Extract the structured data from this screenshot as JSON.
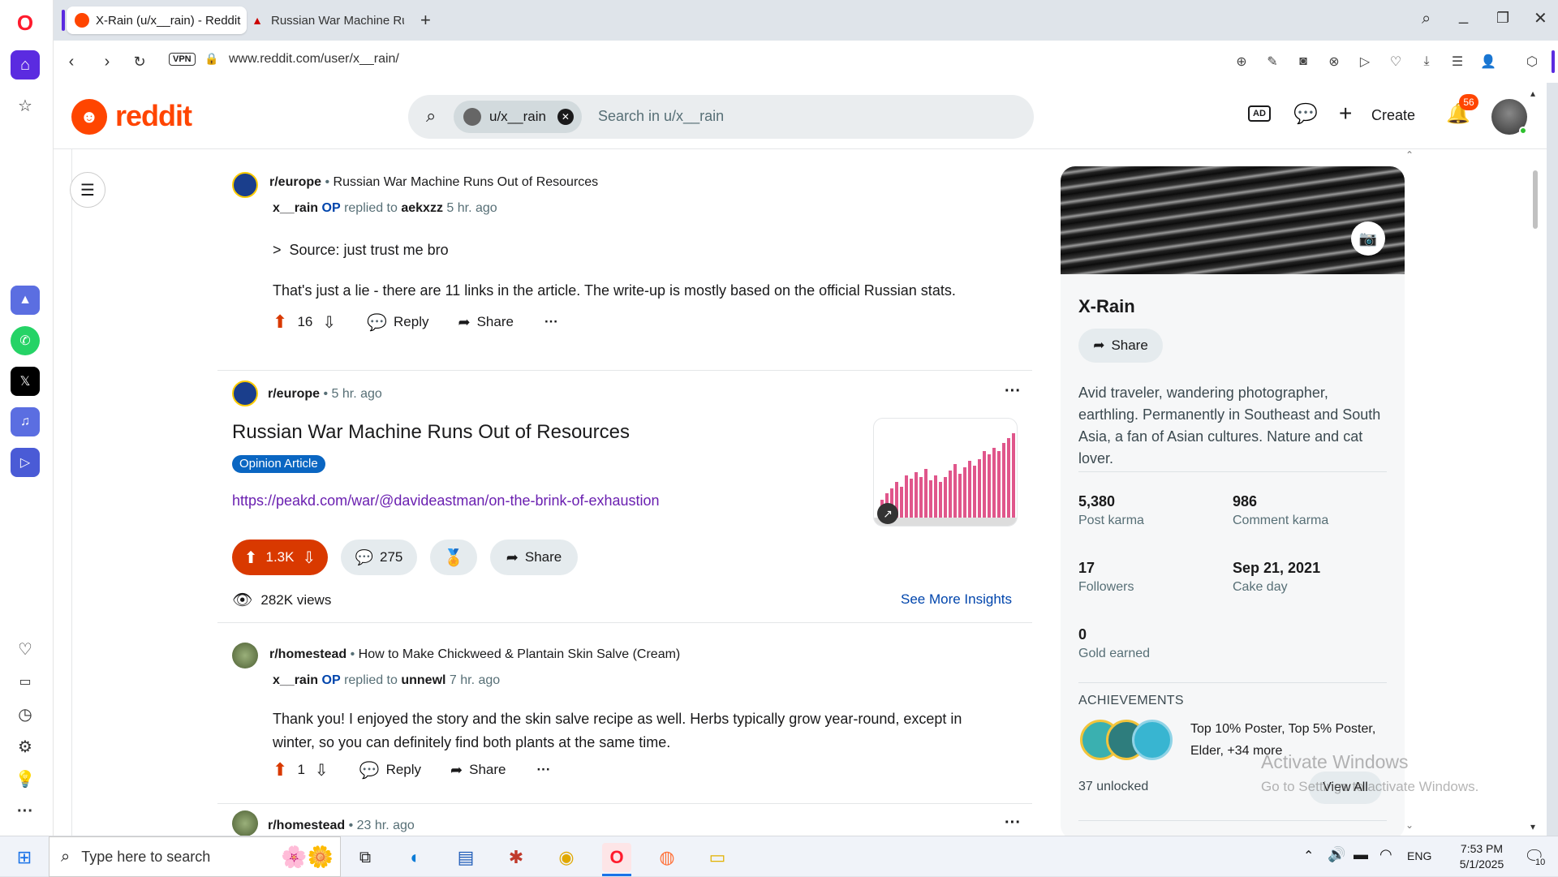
{
  "browser": {
    "tabs": [
      {
        "title": "X-Rain (u/x__rain) - Reddit",
        "active": true
      },
      {
        "title": "Russian War Machine Runs",
        "active": false
      }
    ],
    "url": "www.reddit.com/user/x__rain/",
    "vpn_label": "VPN",
    "notification_badge": ""
  },
  "header": {
    "logo_text": "reddit",
    "search_chip": "u/x__rain",
    "search_placeholder": "Search in u/x__rain",
    "create_label": "Create",
    "notif_count": "56"
  },
  "feed": [
    {
      "type": "comment",
      "subreddit": "r/europe",
      "post_title": "Russian War Machine Runs Out of Resources",
      "author": "x__rain",
      "op": "OP",
      "replied_to_label": "replied to",
      "replied_to": "aekxzz",
      "time": "5 hr. ago",
      "quote": "Source: just trust me bro",
      "body": "That's just a lie - there are 11 links in the article. The write-up is mostly based on the official Russian stats.",
      "score": "16",
      "reply": "Reply",
      "share": "Share"
    },
    {
      "type": "post",
      "subreddit": "r/europe",
      "time": "5 hr. ago",
      "title": "Russian War Machine Runs Out of Resources",
      "flair": "Opinion Article",
      "link": "https://peakd.com/war/@davideastman/on-the-brink-of-exhaustion",
      "score": "1.3K",
      "comments": "275",
      "share": "Share",
      "views": "282K views",
      "insights": "See More Insights"
    },
    {
      "type": "comment",
      "subreddit": "r/homestead",
      "post_title": "How to Make Chickweed & Plantain Skin Salve (Cream)",
      "author": "x__rain",
      "op": "OP",
      "replied_to_label": "replied to",
      "replied_to": "unnewl",
      "time": "7 hr. ago",
      "body_line1": "Thank you! I enjoyed the story and the skin salve recipe as well. Herbs typically grow year-round, except in",
      "body_line2": "winter, so you can definitely find both plants at the same time.",
      "score": "1",
      "reply": "Reply",
      "share": "Share"
    },
    {
      "type": "post_partial",
      "subreddit": "r/homestead",
      "time": "23 hr. ago"
    }
  ],
  "profile": {
    "name": "X-Rain",
    "share": "Share",
    "bio": "Avid traveler, wandering photographer, earthling. Permanently in Southeast and South Asia, a fan of Asian cultures. Nature and cat lover.",
    "stats": [
      {
        "value": "5,380",
        "label": "Post karma"
      },
      {
        "value": "986",
        "label": "Comment karma"
      },
      {
        "value": "17",
        "label": "Followers"
      },
      {
        "value": "Sep 21, 2021",
        "label": "Cake day"
      },
      {
        "value": "0",
        "label": "Gold earned"
      }
    ],
    "achievements_heading": "ACHIEVEMENTS",
    "achievements_text": "Top 10% Poster, Top 5% Poster, Elder, +34 more",
    "unlocked": "37 unlocked",
    "view_all": "View All"
  },
  "watermark": {
    "line1": "Activate Windows",
    "line2": "Go to Settings to activate Windows."
  },
  "taskbar": {
    "search_placeholder": "Type here to search",
    "lang": "ENG",
    "time": "7:53 PM",
    "date": "5/1/2025",
    "notif": "10"
  },
  "colors": {
    "reddit_orange": "#ff4500",
    "upvote_pill": "#d93900",
    "link_purple": "#6a1fb0",
    "flair_blue": "#0a66c2",
    "opera_red": "#ff1b2d"
  }
}
